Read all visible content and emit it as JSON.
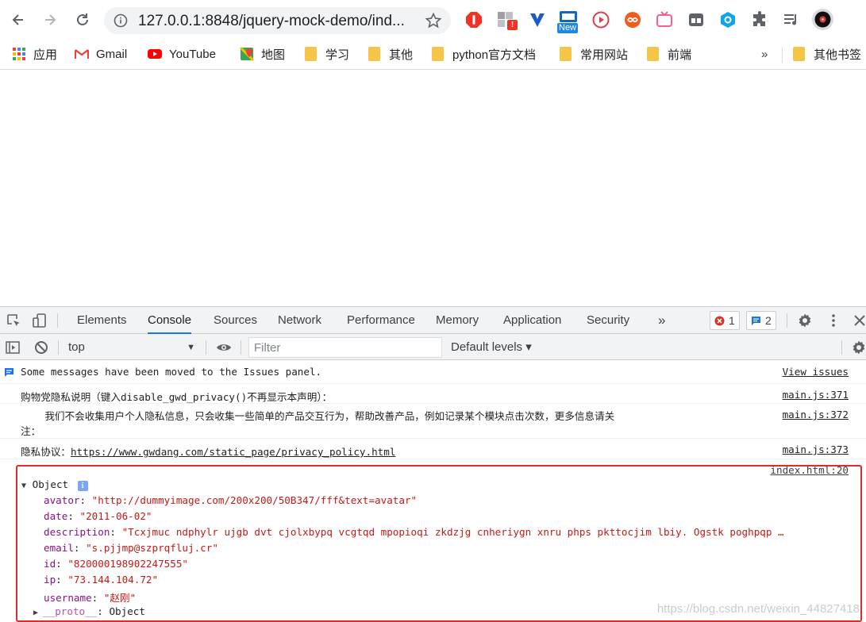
{
  "browser": {
    "url": "127.0.0.1:8848/jquery-mock-demo/ind...",
    "new_badge": "New",
    "bookmarks": [
      {
        "label": "应用"
      },
      {
        "label": "Gmail"
      },
      {
        "label": "YouTube"
      },
      {
        "label": "地图"
      },
      {
        "label": "学习"
      },
      {
        "label": "其他"
      },
      {
        "label": "python官方文档"
      },
      {
        "label": "常用网站"
      },
      {
        "label": "前端"
      },
      {
        "label": "»"
      },
      {
        "label": "其他书签"
      }
    ]
  },
  "devtools": {
    "tabs": [
      "Elements",
      "Console",
      "Sources",
      "Network",
      "Performance",
      "Memory",
      "Application",
      "Security",
      "»"
    ],
    "active_tab": "Console",
    "errors_count": "1",
    "issues_count": "2",
    "context": "top",
    "filter_placeholder": "Filter",
    "levels": "Default levels ▾"
  },
  "console": {
    "issues_msg": "Some messages have been moved to the Issues panel.",
    "view_issues": "View issues",
    "lines": [
      {
        "text": "购物党隐私说明（键入disable_gwd_privacy()不再显示本声明）：",
        "src": "main.js:371"
      },
      {
        "text": "    我们不会收集用户个人隐私信息，只会收集一些简单的产品交互行为，帮助改善产品，例如记录某个模块点击次数，更多信息请关",
        "text2": "注：",
        "src": "main.js:372"
      },
      {
        "prefix": "隐私协议：",
        "link": "https://www.gwdang.com/static_page/privacy_policy.html",
        "src": "main.js:373"
      }
    ],
    "object_src": "index.html:20",
    "object_label": "Object",
    "info_badge": "i",
    "props": [
      {
        "key": "avator",
        "value": "\"http://dummyimage.com/200x200/50B347/fff&text=avatar\""
      },
      {
        "key": "date",
        "value": "\"2011-06-02\""
      },
      {
        "key": "description",
        "value": "\"Tcxjmuc ndphylr ujgb dvt cjolxbypq vcgtqd mpopioqi zkdzjg cnheriygn xnru phps pkttocjim lbiy. Ogstk poghpqp …"
      },
      {
        "key": "email",
        "value": "\"s.pjjmp@szprqfluj.cr\""
      },
      {
        "key": "id",
        "value": "\"820000198902247555\""
      },
      {
        "key": "ip",
        "value": "\"73.144.104.72\""
      },
      {
        "key": "username",
        "value": "\"赵刚\""
      }
    ],
    "proto_key": "__proto__",
    "proto_value": ": Object"
  },
  "watermark": "https://blog.csdn.net/weixin_44827418"
}
